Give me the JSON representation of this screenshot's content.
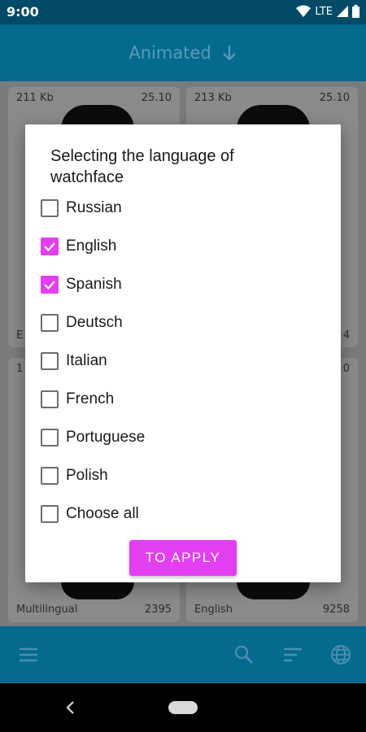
{
  "status_bar": {
    "time": "9:00",
    "network": "LTE",
    "icons": [
      "wifi-icon",
      "signal-icon",
      "battery-icon"
    ]
  },
  "app_bar": {
    "title": "Animated",
    "sort_icon": "arrow-down-icon"
  },
  "cards": [
    {
      "size": "211 Kb",
      "version": "25.10",
      "language": "",
      "downloads": ""
    },
    {
      "size": "213 Kb",
      "version": "25.10",
      "language": "",
      "downloads": ""
    },
    {
      "size": "",
      "version": "",
      "language": "Multilingual",
      "downloads": "2395"
    },
    {
      "size": "",
      "version": "",
      "language": "English",
      "downloads": "9258"
    }
  ],
  "partial_text": {
    "left_row1": "E",
    "right_row1": "4",
    "left_row2": "1",
    "right_row2": "0"
  },
  "dialog": {
    "title": "Selecting the language of watchface",
    "options": [
      {
        "label": "Russian",
        "checked": false
      },
      {
        "label": "English",
        "checked": true
      },
      {
        "label": "Spanish",
        "checked": true
      },
      {
        "label": "Deutsch",
        "checked": false
      },
      {
        "label": "Italian",
        "checked": false
      },
      {
        "label": "French",
        "checked": false
      },
      {
        "label": "Portuguese",
        "checked": false
      },
      {
        "label": "Polish",
        "checked": false
      },
      {
        "label": "Choose all",
        "checked": false
      }
    ],
    "apply_label": "TO APPLY"
  },
  "bottom_bar": {
    "icons": [
      "menu-icon",
      "search-icon",
      "sort-icon",
      "globe-icon"
    ]
  },
  "colors": {
    "accent": "#e33ff0",
    "primary": "#046a8e",
    "status_bar": "#024b67"
  }
}
